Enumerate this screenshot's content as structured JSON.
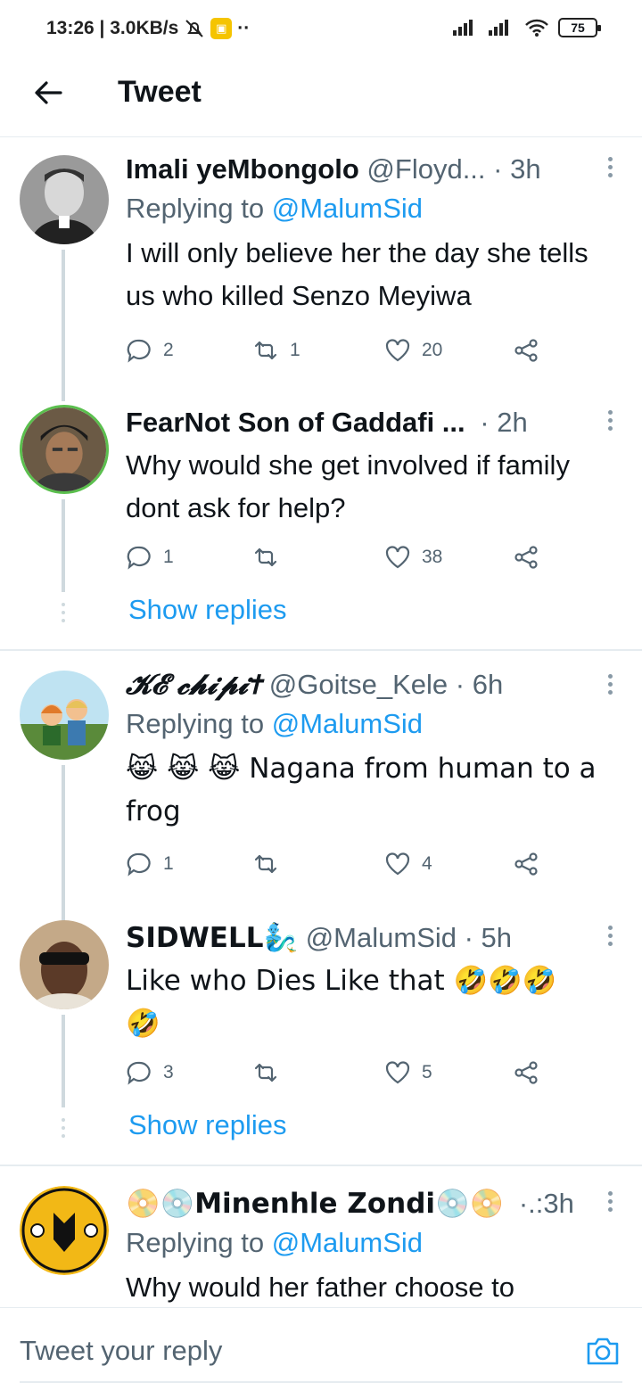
{
  "status_bar": {
    "time_and_speed": "13:26 | 3.0KB/s",
    "dots": "··",
    "battery": "75"
  },
  "header": {
    "title": "Tweet"
  },
  "tweets": [
    {
      "name": "Imali yeMbongolo",
      "handle": "@Floyd...",
      "time": "· 3h",
      "replying_prefix": "Replying to",
      "replying_handle": "@MalumSid",
      "text": "I will only believe her the day she tells us who killed Senzo Meyiwa",
      "replies": "2",
      "retweets": "1",
      "likes": "20"
    },
    {
      "name": "FearNot Son of Gaddafi ...",
      "handle": "",
      "time": "· 2h",
      "text": "Why would she get involved if family dont ask for help?",
      "replies": "1",
      "retweets": "",
      "likes": "38",
      "show_replies": "Show replies"
    },
    {
      "name": "𝓚𝓔 𝓬𝓱𝓲𝓹𝓲✝",
      "handle": "@Goitse_Kele",
      "time": "· 6h",
      "replying_prefix": "Replying to",
      "replying_handle": "@MalumSid",
      "text": "😹 😹 😹 Nagana from human to a frog",
      "replies": "1",
      "retweets": "",
      "likes": "4"
    },
    {
      "name": "SIDWELL🧞‍♂️",
      "handle": "@MalumSid",
      "time": "· 5h",
      "text": "Like who Dies Like that 🤣🤣🤣🤣",
      "replies": "3",
      "retweets": "",
      "likes": "5",
      "show_replies": "Show replies"
    },
    {
      "name": "📀💿Minenhle Zondi💿📀",
      "handle": "",
      "time": "·.:3h",
      "replying_prefix": "Replying to",
      "replying_handle": "@MalumSid",
      "text": "Why would her father choose to"
    }
  ],
  "reply_bar": {
    "placeholder": "Tweet your reply"
  },
  "colors": {
    "accent": "#1d9bf0",
    "secondary_text": "#536471",
    "thread_line": "#cfd9de"
  }
}
